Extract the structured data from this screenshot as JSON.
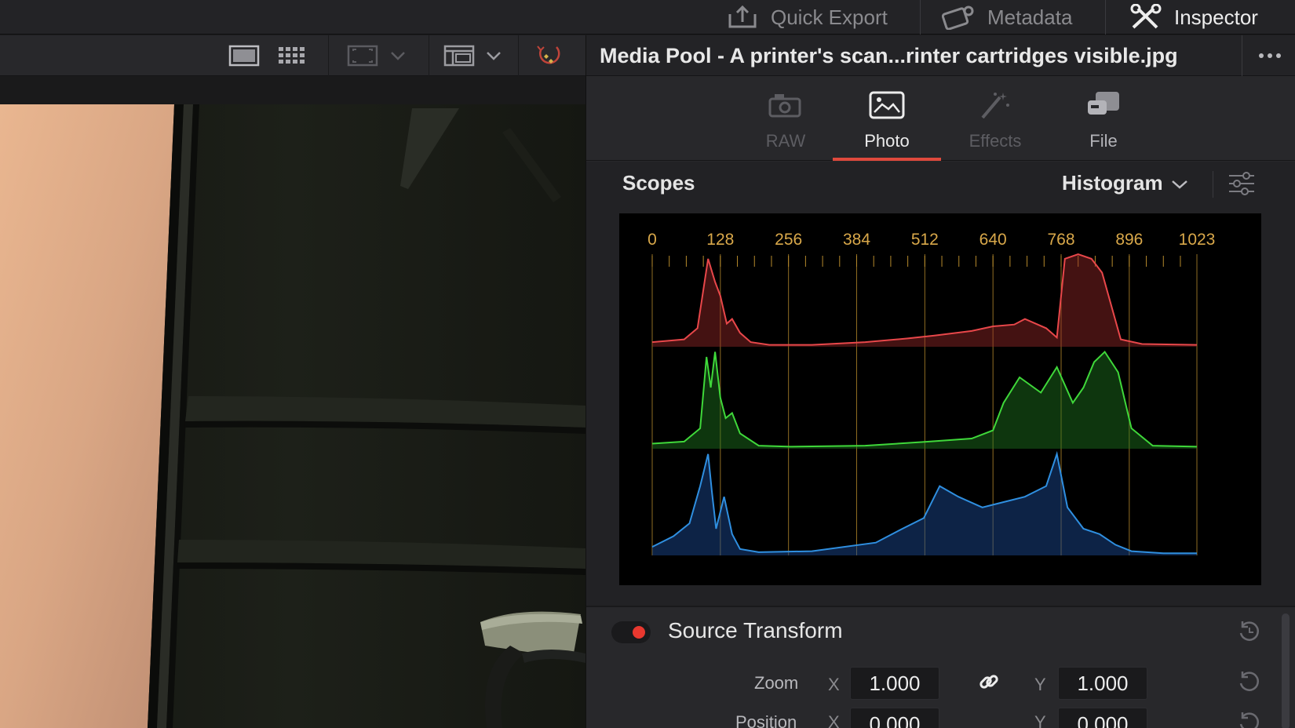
{
  "header": {
    "quick_export": "Quick Export",
    "metadata": "Metadata",
    "inspector": "Inspector"
  },
  "viewer_toolbar": {
    "icons": [
      "single-view-icon",
      "grid-view-icon",
      "safe-area-icon",
      "layout-icon",
      "transform-overlay-icon"
    ]
  },
  "inspector": {
    "title": "Media Pool - A printer's scan...rinter cartridges visible.jpg",
    "tabs": [
      {
        "label": "RAW",
        "state": "disabled"
      },
      {
        "label": "Photo",
        "state": "active"
      },
      {
        "label": "Effects",
        "state": "disabled"
      },
      {
        "label": "File",
        "state": "normal"
      }
    ],
    "scopes": {
      "title": "Scopes",
      "mode": "Histogram"
    },
    "source_transform": {
      "title": "Source Transform",
      "zoom_label": "Zoom",
      "zoom_x_axis": "X",
      "zoom_x": "1.000",
      "zoom_y_axis": "Y",
      "zoom_y": "1.000",
      "position_label": "Position",
      "position_x_axis": "X",
      "position_x": "0.000",
      "position_y_axis": "Y",
      "position_y": "0.000"
    }
  },
  "colors": {
    "accent": "#e0493d",
    "red_channel": "#e8474a",
    "green_channel": "#3fd83a",
    "blue_channel": "#2f8fe0",
    "gridline": "#b68a2c"
  },
  "chart_data": {
    "type": "area",
    "title": "",
    "x_ticks": [
      "0",
      "128",
      "256",
      "384",
      "512",
      "640",
      "768",
      "896",
      "1023"
    ],
    "xlim": [
      0,
      1023
    ],
    "grid": true,
    "series": [
      {
        "name": "Red",
        "x": [
          0,
          60,
          85,
          105,
          118,
          128,
          140,
          150,
          165,
          185,
          220,
          300,
          400,
          480,
          530,
          600,
          640,
          680,
          700,
          740,
          760,
          775,
          800,
          825,
          845,
          880,
          920,
          1023
        ],
        "y": [
          0.05,
          0.08,
          0.2,
          0.95,
          0.7,
          0.55,
          0.25,
          0.3,
          0.15,
          0.05,
          0.02,
          0.02,
          0.05,
          0.09,
          0.12,
          0.17,
          0.22,
          0.24,
          0.3,
          0.2,
          0.1,
          0.95,
          1.0,
          0.95,
          0.8,
          0.08,
          0.03,
          0.02
        ]
      },
      {
        "name": "Green",
        "x": [
          0,
          60,
          90,
          102,
          110,
          118,
          128,
          138,
          150,
          165,
          200,
          260,
          400,
          520,
          600,
          640,
          660,
          690,
          730,
          760,
          790,
          810,
          830,
          850,
          875,
          900,
          940,
          1023
        ],
        "y": [
          0.05,
          0.07,
          0.2,
          0.9,
          0.6,
          0.95,
          0.5,
          0.3,
          0.35,
          0.15,
          0.03,
          0.02,
          0.03,
          0.07,
          0.1,
          0.18,
          0.45,
          0.7,
          0.55,
          0.8,
          0.45,
          0.6,
          0.85,
          0.95,
          0.75,
          0.2,
          0.03,
          0.02
        ]
      },
      {
        "name": "Blue",
        "x": [
          0,
          40,
          70,
          90,
          105,
          112,
          120,
          135,
          150,
          165,
          200,
          300,
          420,
          470,
          510,
          540,
          575,
          620,
          660,
          700,
          740,
          760,
          780,
          810,
          840,
          870,
          900,
          960,
          1023
        ],
        "y": [
          0.08,
          0.18,
          0.3,
          0.65,
          0.95,
          0.6,
          0.25,
          0.55,
          0.2,
          0.06,
          0.03,
          0.04,
          0.12,
          0.25,
          0.35,
          0.65,
          0.55,
          0.45,
          0.5,
          0.55,
          0.65,
          0.95,
          0.45,
          0.25,
          0.2,
          0.1,
          0.04,
          0.02,
          0.02
        ]
      }
    ]
  }
}
